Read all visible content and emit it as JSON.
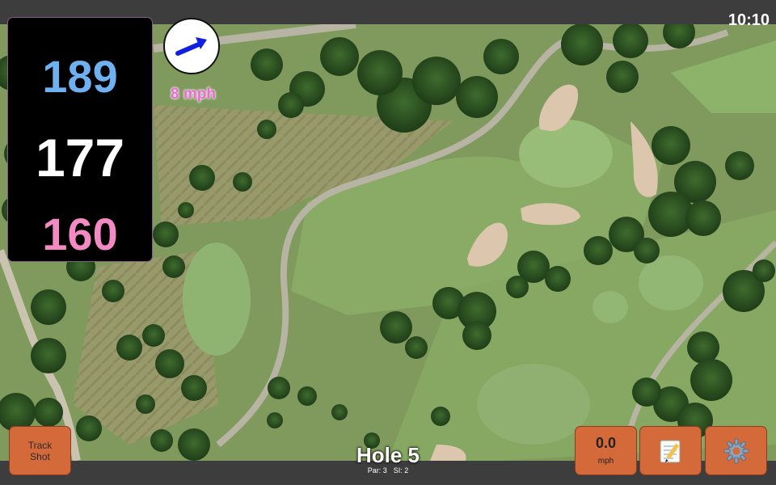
{
  "status": {
    "clock": "10:10"
  },
  "yardages": {
    "back": "189",
    "middle": "177",
    "front": "160"
  },
  "wind": {
    "speed": "8 mph",
    "icon": "wind-direction-arrow-icon",
    "arrow_color": "#1020e0"
  },
  "hole": {
    "title": "Hole 5",
    "par": "Par: 3",
    "stroke_index": "SI: 2"
  },
  "buttons": {
    "track_shot_line1": "Track",
    "track_shot_line2": "Shot",
    "shot_speed_value": "0.0",
    "shot_speed_unit": "mph",
    "notes_icon": "notepad-icon",
    "settings_icon": "gear-icon"
  },
  "colors": {
    "back_yardage": "#6fb1f0",
    "middle_yardage": "#ffffff",
    "front_yardage": "#f48ac3",
    "button": "#d4693a",
    "wind_text": "#ec6ad5"
  }
}
